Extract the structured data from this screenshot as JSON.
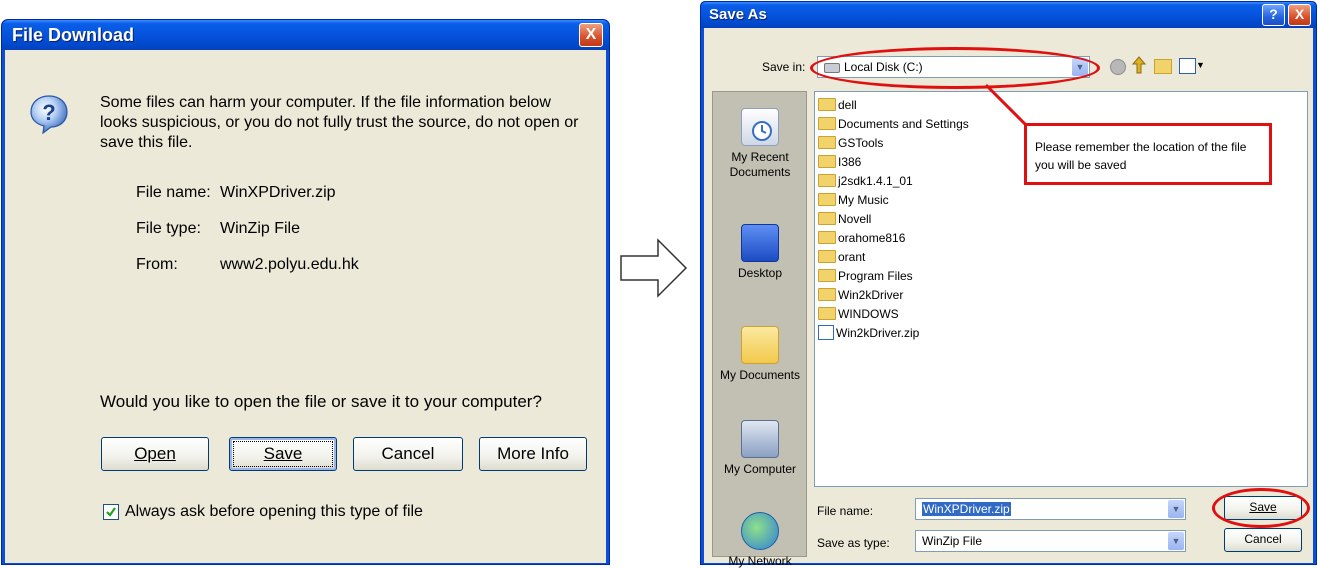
{
  "file_download": {
    "title": "File Download",
    "close_label": "X",
    "warning_text": [
      "Some files can harm your computer. If the file information below",
      "looks suspicious, or you do not fully trust the source, do not open or",
      "save this file."
    ],
    "file_name_label": "File name:",
    "file_name_value": "WinXPDriver.zip",
    "file_type_label": "File type:",
    "file_type_value": "WinZip File",
    "from_label": "From:",
    "from_value": "www2.polyu.edu.hk",
    "question": "Would you like to open the file or save it to your computer?",
    "buttons": {
      "open": "Open",
      "save": "Save",
      "cancel": "Cancel",
      "more_info": "More Info"
    },
    "always_ask_label": "Always ask before opening this type of file",
    "always_ask_checked": true
  },
  "save_as": {
    "title": "Save As",
    "help_label": "?",
    "close_label": "X",
    "save_in_label": "Save in:",
    "save_in_value": "Local Disk (C:)",
    "places": [
      {
        "label": "My Recent Documents",
        "icon": "recent-documents-icon"
      },
      {
        "label": "Desktop",
        "icon": "desktop-icon"
      },
      {
        "label": "My Documents",
        "icon": "my-documents-icon"
      },
      {
        "label": "My Computer",
        "icon": "my-computer-icon"
      },
      {
        "label": "My Network",
        "icon": "my-network-icon"
      }
    ],
    "files": [
      {
        "name": "dell",
        "type": "folder"
      },
      {
        "name": "Documents and Settings",
        "type": "folder"
      },
      {
        "name": "GSTools",
        "type": "folder"
      },
      {
        "name": "I386",
        "type": "folder"
      },
      {
        "name": "j2sdk1.4.1_01",
        "type": "folder"
      },
      {
        "name": "My Music",
        "type": "folder"
      },
      {
        "name": "Novell",
        "type": "folder"
      },
      {
        "name": "orahome816",
        "type": "folder"
      },
      {
        "name": "orant",
        "type": "folder"
      },
      {
        "name": "Program Files",
        "type": "folder"
      },
      {
        "name": "Win2kDriver",
        "type": "folder"
      },
      {
        "name": "WINDOWS",
        "type": "folder"
      },
      {
        "name": "Win2kDriver.zip",
        "type": "zip"
      }
    ],
    "annotation": "Please remember the location of the file you will be saved",
    "file_name_label": "File name:",
    "file_name_value": "WinXPDriver.zip",
    "save_as_type_label": "Save as type:",
    "save_as_type_value": "WinZip File",
    "save_button": "Save",
    "cancel_button": "Cancel"
  },
  "colors": {
    "xp_blue": "#0b4fd6",
    "dialog_bg": "#ece9d8",
    "annotation_red": "#e01010",
    "selection_blue": "#316ac5"
  }
}
